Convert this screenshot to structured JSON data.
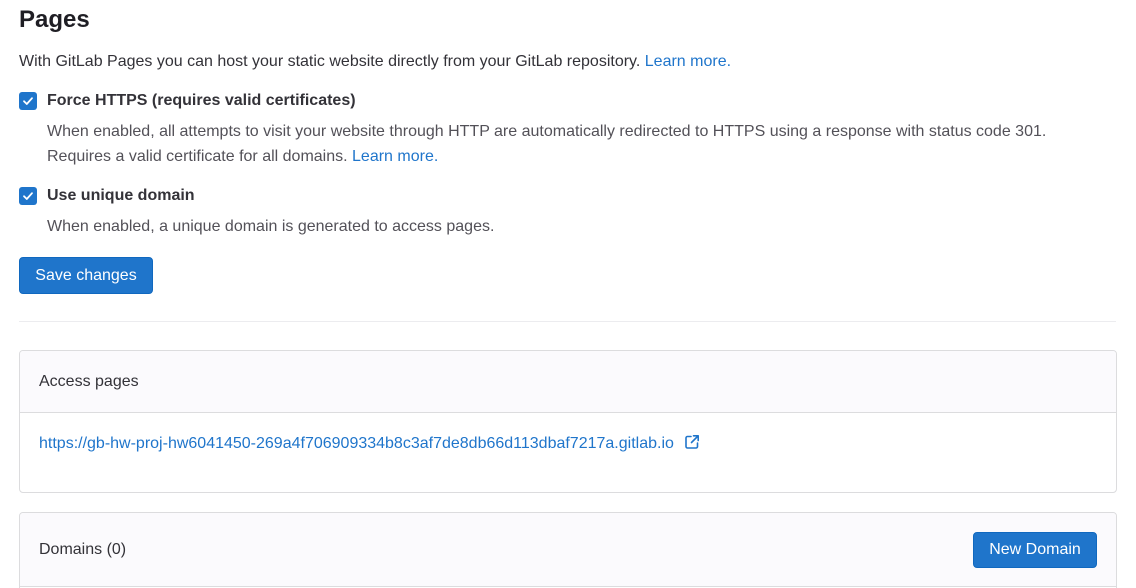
{
  "header": {
    "title": "Pages"
  },
  "intro": {
    "text": "With GitLab Pages you can host your static website directly from your GitLab repository.",
    "link": "Learn more."
  },
  "force_https": {
    "label": "Force HTTPS (requires valid certificates)",
    "checked": true,
    "help_line1": "When enabled, all attempts to visit your website through HTTP are automatically redirected to HTTPS using a response with status code 301.",
    "help_line2": "Requires a valid certificate for all domains.",
    "help_link": "Learn more."
  },
  "unique_domain": {
    "label": "Use unique domain",
    "checked": true,
    "help": "When enabled, a unique domain is generated to access pages."
  },
  "actions": {
    "save_label": "Save changes"
  },
  "access_pages": {
    "header": "Access pages",
    "url": "https://gb-hw-proj-hw6041450-269a4f706909334b8c3af7de8db66d113dbaf7217a.gitlab.io",
    "icon": "external-link-icon"
  },
  "domains": {
    "header": "Domains (0)",
    "new_domain_label": "New Domain"
  },
  "colors": {
    "accent": "#1f75cb",
    "text": "#333238",
    "muted": "#535158",
    "border": "#dcdcde",
    "card_header_bg": "#fbfafd"
  }
}
